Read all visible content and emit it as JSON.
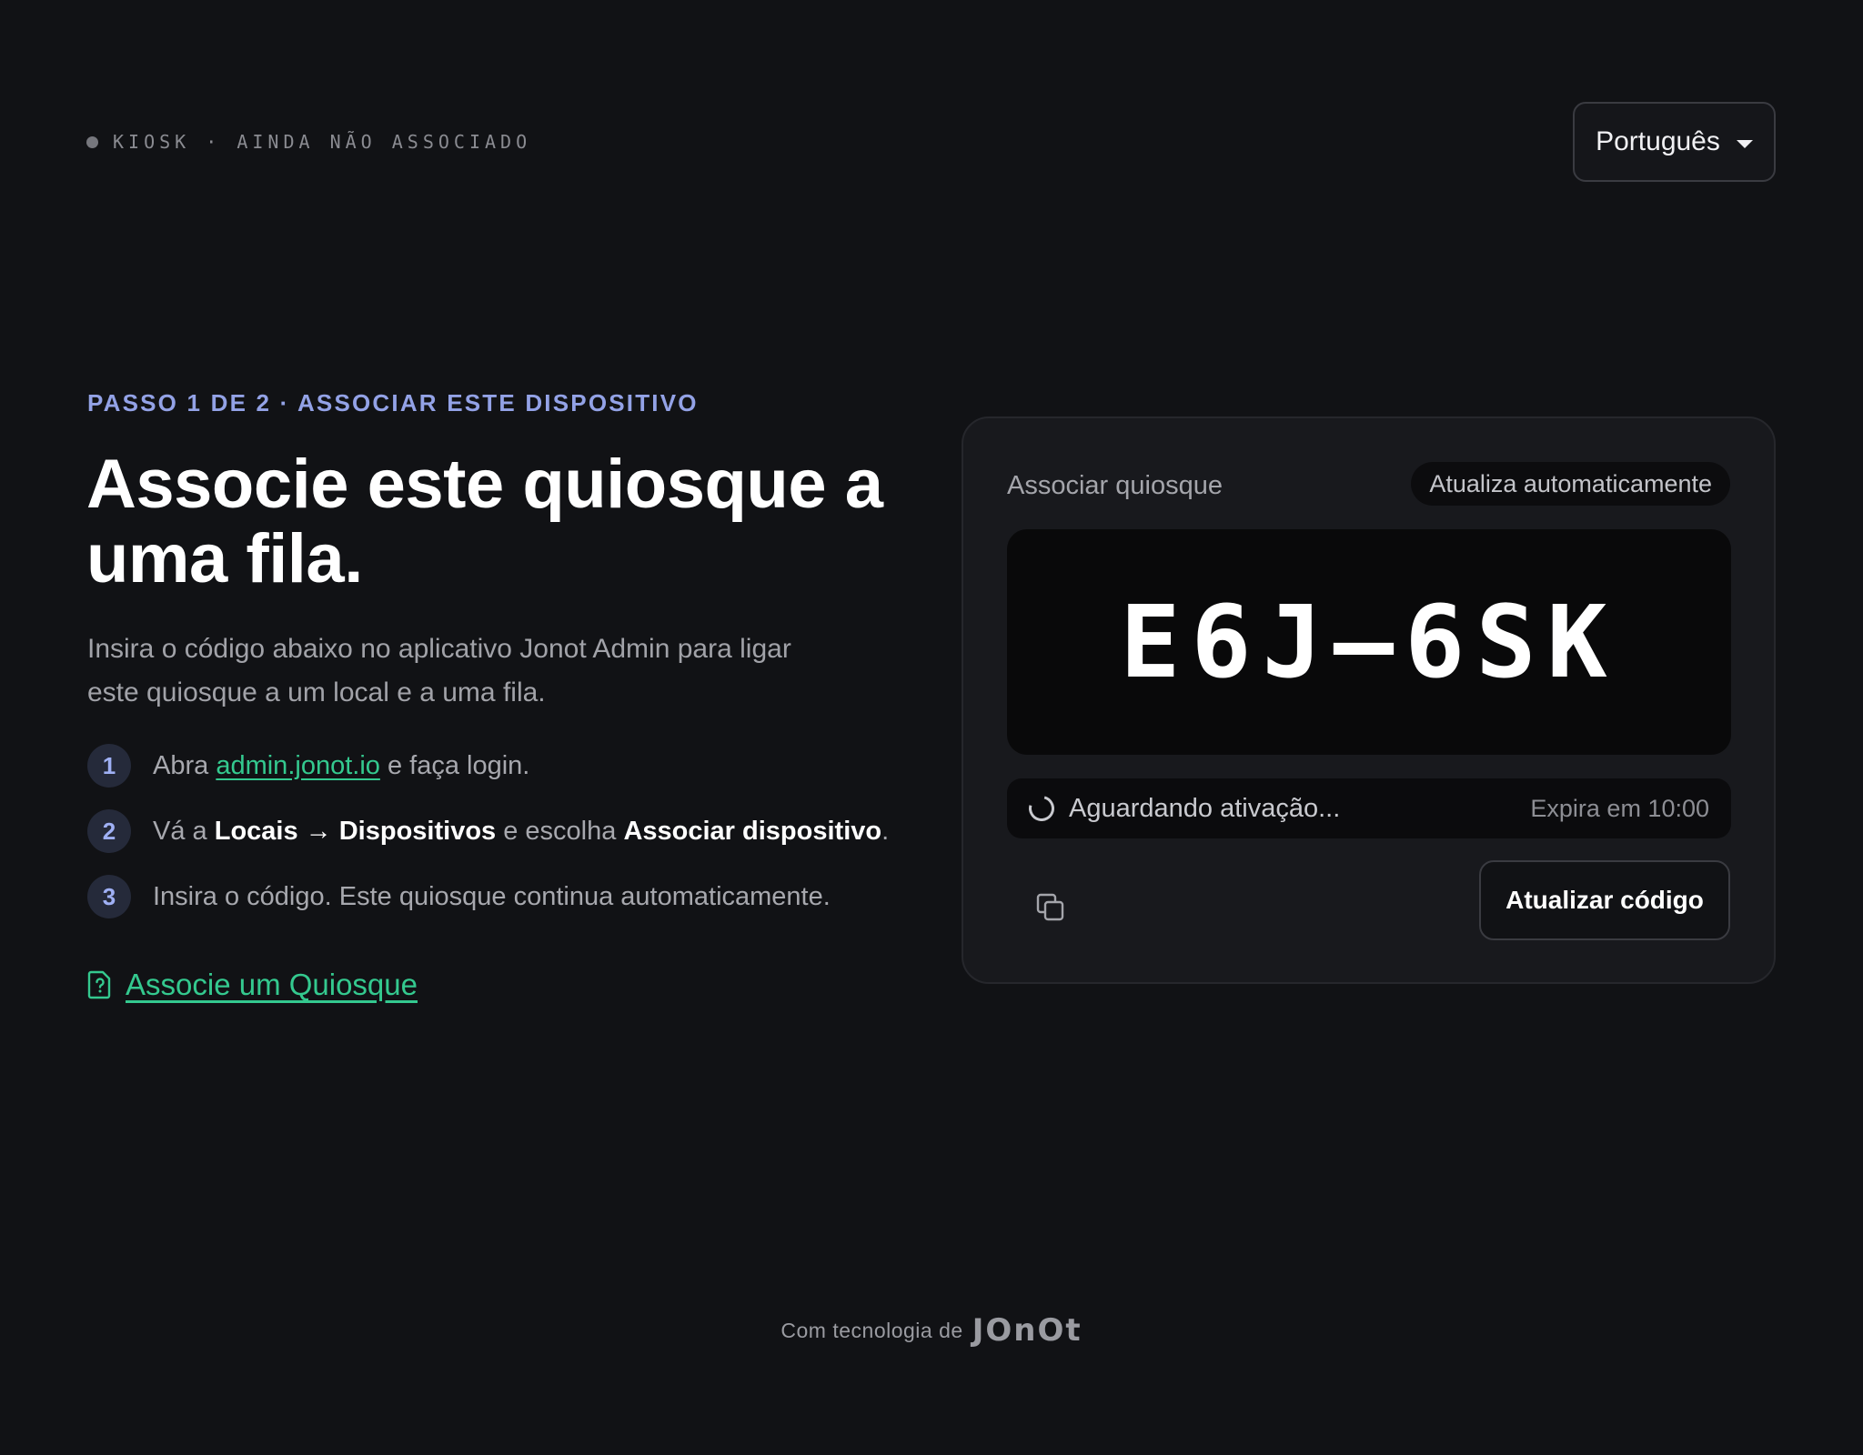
{
  "header": {
    "status_label": "KIOSK · AINDA NÃO ASSOCIADO",
    "language": "Português"
  },
  "intro": {
    "eyebrow": "PASSO 1 DE 2 · ASSOCIAR ESTE DISPOSITIVO",
    "title": "Associe este quiosque a uma fila.",
    "subtitle": "Insira o código abaixo no aplicativo Jonot Admin para ligar este quiosque a um local e a uma fila."
  },
  "steps": [
    {
      "number": "1",
      "prefix": "Abra",
      "link": "admin.jonot.io",
      "suffix": "e faça login."
    },
    {
      "number": "2",
      "prefix": "Vá a",
      "bold1": "Locais",
      "arrow": "→",
      "bold2": "Dispositivos",
      "middle": "e escolha",
      "bold3": "Associar dispositivo",
      "end": "."
    },
    {
      "number": "3",
      "text": "Insira o código. Este quiosque continua automaticamente."
    }
  ],
  "help_link": "Associe um Quiosque",
  "card": {
    "title": "Associar quiosque",
    "auto_refresh_badge": "Atualiza automaticamente",
    "code": "E6J–6SK",
    "status": "Aguardando ativação...",
    "expiry": "Expira em 10:00",
    "refresh_button": "Atualizar código"
  },
  "footer": {
    "text": "Com tecnologia de",
    "brand": "JOnOt"
  },
  "colors": {
    "background": "#111215",
    "accent_blue": "#93a2e6",
    "accent_green": "#34c98f",
    "card": "#18191d"
  },
  "icons": {
    "copy": "copy-icon",
    "spinner": "spinner-icon",
    "help": "help-document-icon",
    "caret": "caret-down-icon"
  }
}
